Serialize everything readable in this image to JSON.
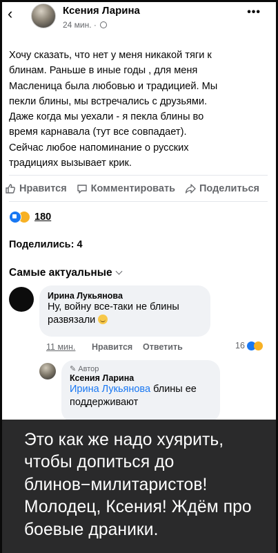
{
  "header": {
    "back_icon": "chevron-left-icon",
    "author": "Ксения Ларина",
    "time": "24 мин. ·",
    "more_icon": "more-horizontal-icon"
  },
  "post": {
    "lines": [
      "Хочу сказать, что нет у меня никакой тяги к",
      "блинам. Раньше в иные годы , для меня",
      "Масленица была любовью и традицией.  Мы",
      "пекли блины, мы встречались с друзьями.",
      "Даже когда мы уехали - я пекла блины во",
      "время карнавала (тут все совпадает).",
      "Сейчас любое напоминание о русских",
      "традициях вызывает крик."
    ]
  },
  "actions": {
    "like": "Нравится",
    "comment": "Комментировать",
    "share": "Поделиться"
  },
  "reactions": {
    "count": "180"
  },
  "shares": "Поделились: 4",
  "sort": "Самые актуальные",
  "comment1": {
    "author": "Ирина Лукьянова",
    "line1": "Ну, войну все-таки не блины",
    "line2": "развязали",
    "time": "11 мин.",
    "like": "Нравится",
    "reply": "Ответить",
    "reaction_count": "16"
  },
  "comment2": {
    "badge": "Автор",
    "author": "Ксения Ларина",
    "mention": "Ирина Лукьянова",
    "text_after": " блины ее",
    "line2": "поддерживают"
  },
  "overlay": {
    "text": "Это как же надо хуярить, чтобы допиться до блинов−милитаристов! Молодец, Ксения! Ждём про боевые драники."
  },
  "colors": {
    "accent": "#1877f2",
    "overlay_bg": "#2a2a2b",
    "muted": "#65676b"
  }
}
